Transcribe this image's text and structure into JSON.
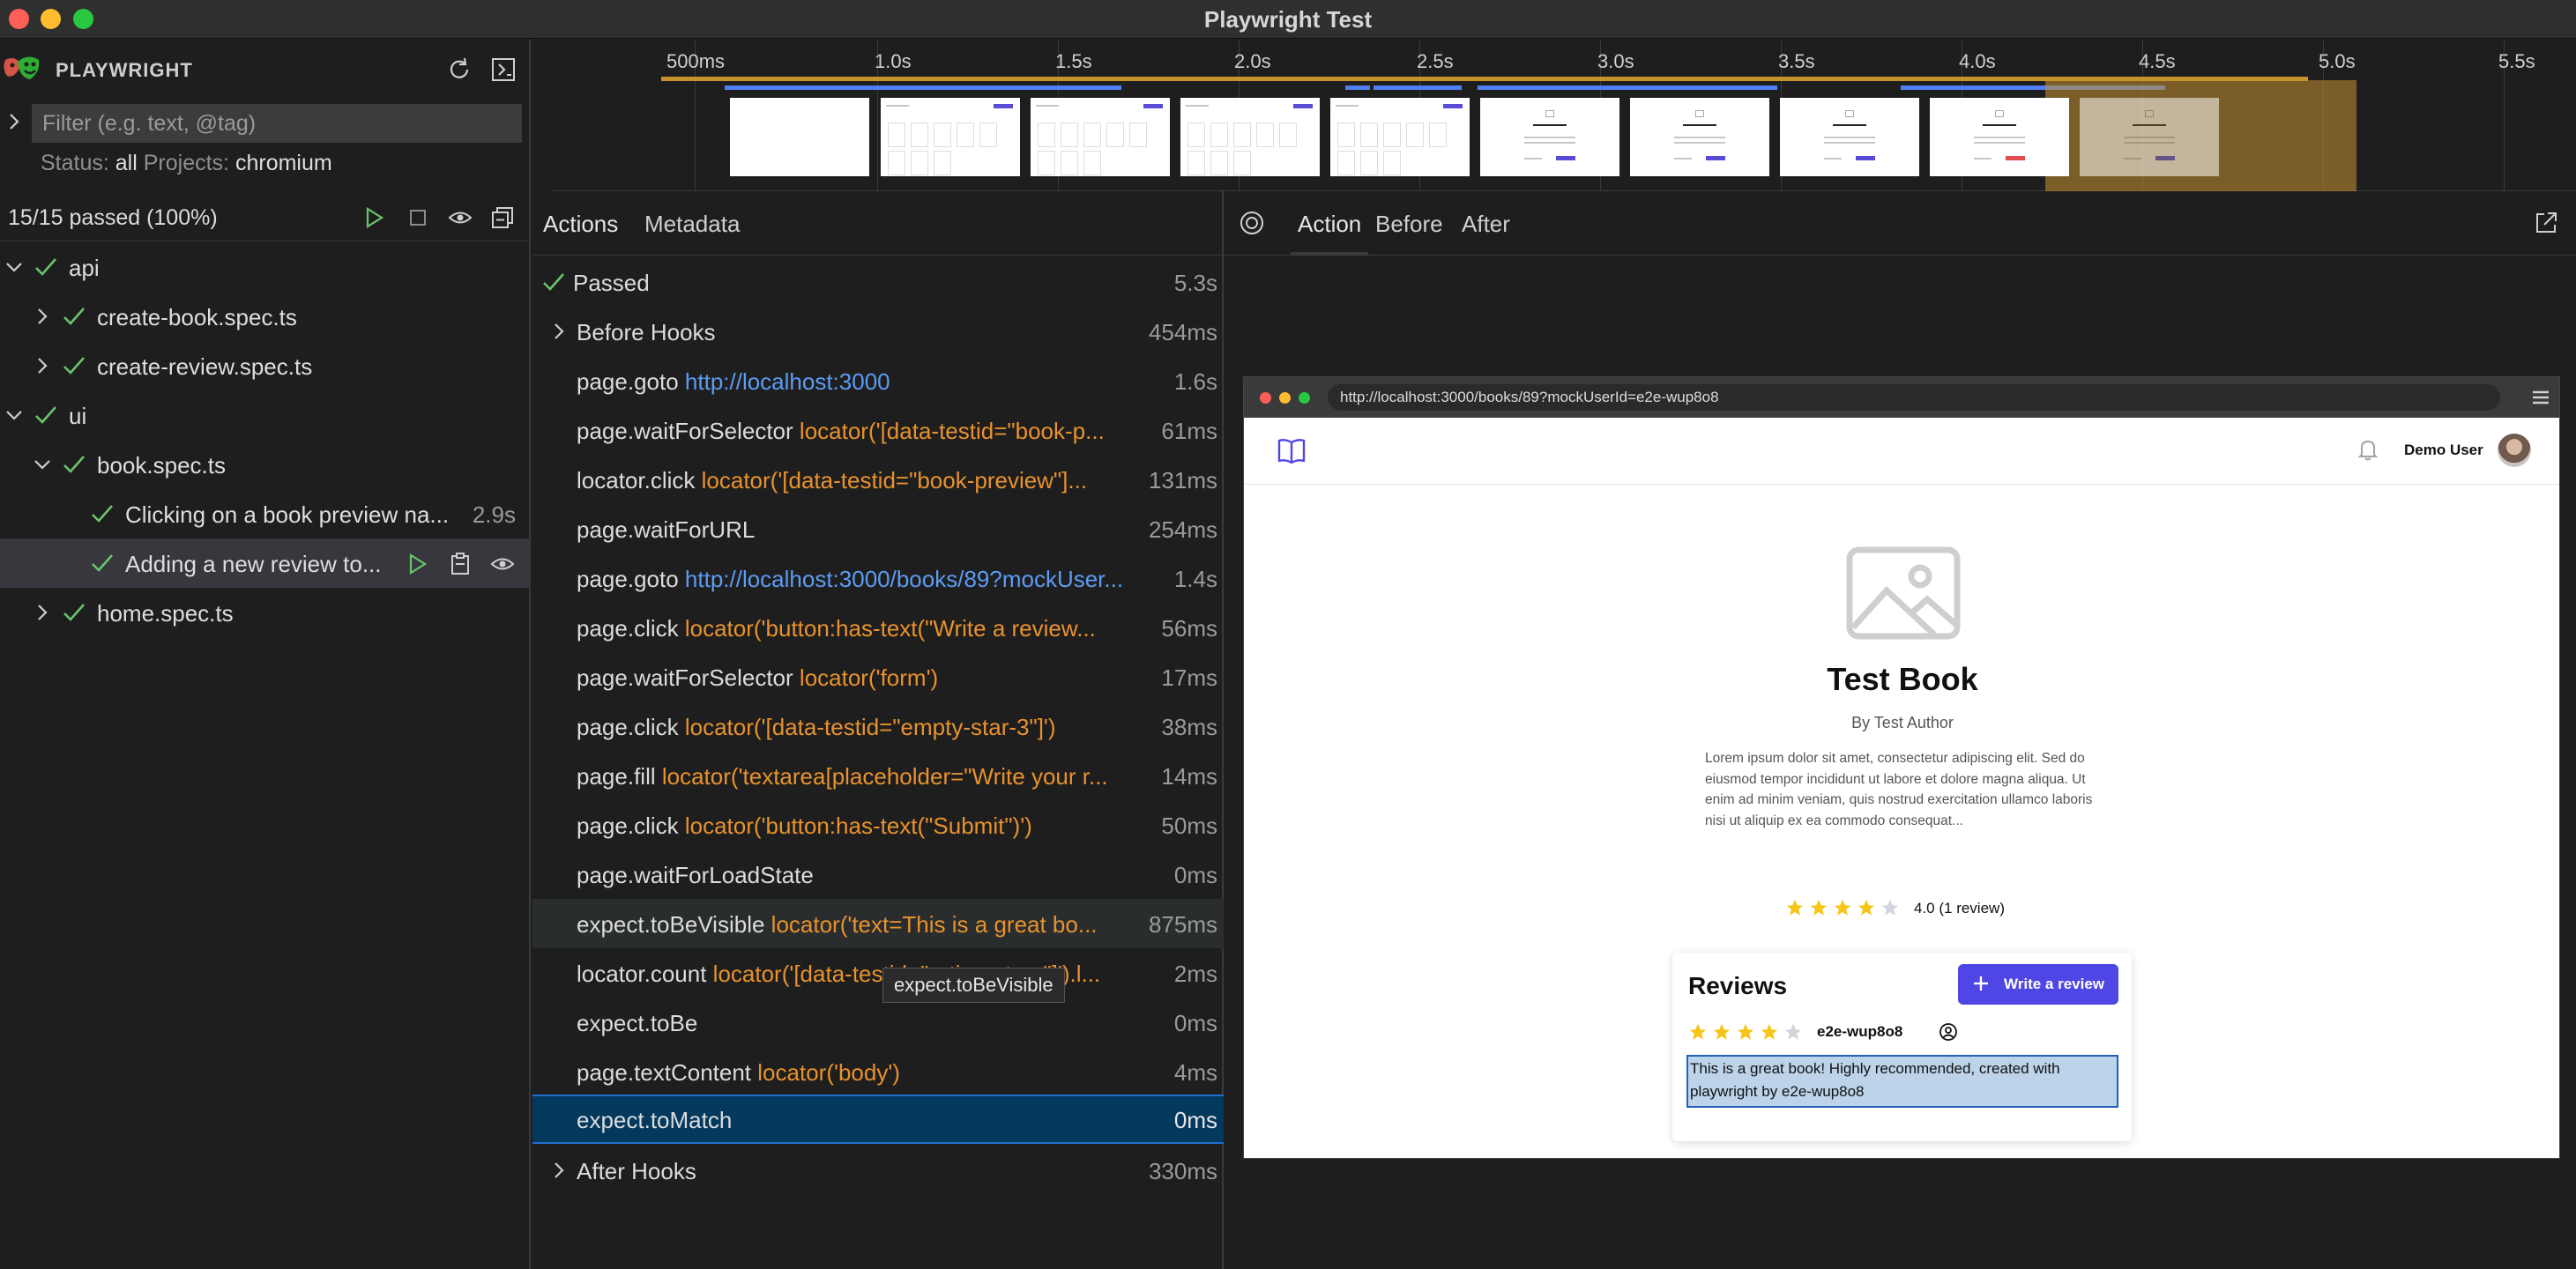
{
  "window": {
    "title": "Playwright Test"
  },
  "sidebar": {
    "app_name": "PLAYWRIGHT",
    "filter_placeholder": "Filter (e.g. text, @tag)",
    "status_label": "Status:",
    "status_value": "all",
    "projects_label": "Projects:",
    "projects_value": "chromium",
    "summary": "15/15 passed (100%)",
    "tree": [
      {
        "label": "api",
        "expanded": true
      },
      {
        "label": "create-book.spec.ts",
        "expanded": false
      },
      {
        "label": "create-review.spec.ts",
        "expanded": false
      },
      {
        "label": "ui",
        "expanded": true
      },
      {
        "label": "book.spec.ts",
        "expanded": true
      },
      {
        "label": "Clicking on a book preview na...",
        "duration": "2.9s"
      },
      {
        "label": "Adding a new review to...",
        "selected": true
      },
      {
        "label": "home.spec.ts",
        "expanded": false
      }
    ]
  },
  "timeline": {
    "ticks": [
      "500ms",
      "1.0s",
      "1.5s",
      "2.0s",
      "2.5s",
      "3.0s",
      "3.5s",
      "4.0s",
      "4.5s",
      "5.0s",
      "5.5s"
    ]
  },
  "actions_panel": {
    "tabs": [
      "Actions",
      "Metadata"
    ],
    "status": {
      "label": "Passed",
      "duration": "5.3s"
    },
    "actions": [
      {
        "name": "Before Hooks",
        "duration": "454ms"
      },
      {
        "name": "page.goto",
        "arg": "http://localhost:3000",
        "arg_type": "url",
        "duration": "1.6s"
      },
      {
        "name": "page.waitForSelector",
        "arg": "locator('[data-testid=\"book-p...",
        "arg_type": "locator",
        "duration": "61ms"
      },
      {
        "name": "locator.click",
        "arg": "locator('[data-testid=\"book-preview\"]...",
        "arg_type": "locator",
        "duration": "131ms"
      },
      {
        "name": "page.waitForURL",
        "arg": "",
        "duration": "254ms"
      },
      {
        "name": "page.goto",
        "arg": "http://localhost:3000/books/89?mockUser...",
        "arg_type": "url",
        "duration": "1.4s"
      },
      {
        "name": "page.click",
        "arg": "locator('button:has-text(\"Write a review...",
        "arg_type": "locator",
        "duration": "56ms"
      },
      {
        "name": "page.waitForSelector",
        "arg": "locator('form')",
        "arg_type": "locator",
        "duration": "17ms"
      },
      {
        "name": "page.click",
        "arg": "locator('[data-testid=\"empty-star-3\"]')",
        "arg_type": "locator",
        "duration": "38ms"
      },
      {
        "name": "page.fill",
        "arg": "locator('textarea[placeholder=\"Write your r...",
        "arg_type": "locator",
        "duration": "14ms"
      },
      {
        "name": "page.click",
        "arg": "locator('button:has-text(\"Submit\")')",
        "arg_type": "locator",
        "duration": "50ms"
      },
      {
        "name": "page.waitForLoadState",
        "arg": "",
        "duration": "0ms"
      },
      {
        "name": "expect.toBeVisible",
        "arg": "locator('text=This is a great bo...",
        "arg_type": "locator",
        "duration": "875ms"
      },
      {
        "name": "locator.count",
        "arg": "locator('[data-testid=\"rating-stars\"]').l...",
        "arg_type": "locator",
        "duration": "2ms"
      },
      {
        "name": "expect.toBe",
        "arg": "",
        "duration": "0ms"
      },
      {
        "name": "page.textContent",
        "arg": "locator('body')",
        "arg_type": "locator",
        "duration": "4ms"
      },
      {
        "name": "expect.toMatch",
        "arg": "",
        "duration": "0ms"
      },
      {
        "name": "After Hooks",
        "duration": "330ms"
      }
    ],
    "tooltip": "expect.toBeVisible"
  },
  "snapshot_panel": {
    "tabs": [
      "Action",
      "Before",
      "After"
    ],
    "browser": {
      "url": "http://localhost:3000/books/89?mockUserId=e2e-wup8o8",
      "user_name": "Demo User",
      "book_title": "Test Book",
      "book_author": "By Test Author",
      "book_description": "Lorem ipsum dolor sit amet, consectetur adipiscing elit. Sed do eiusmod tempor incididunt ut labore et dolore magna aliqua. Ut enim ad minim veniam, quis nostrud exercitation ullamco laboris nisi ut aliquip ex ea commodo consequat...",
      "rating_value": 4,
      "rating_max": 5,
      "rating_text": "4.0 (1 review)",
      "reviews_title": "Reviews",
      "write_review_label": "Write a review",
      "review": {
        "stars": 4,
        "user": "e2e-wup8o8",
        "text": "This is a great book! Highly recommended, created with playwright by e2e-wup8o8"
      }
    }
  },
  "colors": {
    "pass_green": "#6bc46d",
    "locator_orange": "#e8922d",
    "url_blue": "#5c9cf5",
    "brand_indigo": "#4f46e5",
    "star_yellow": "#f5c518",
    "selected_row": "#04395e"
  }
}
